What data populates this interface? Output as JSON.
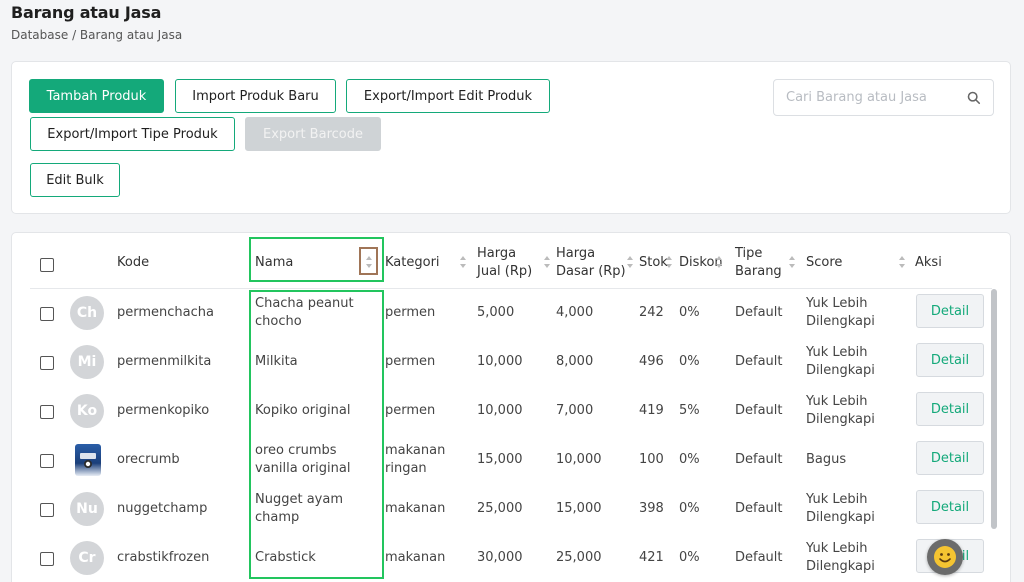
{
  "page": {
    "title": "Barang atau Jasa",
    "breadcrumb": "Database / Barang atau Jasa"
  },
  "toolbar": {
    "tambah_produk": "Tambah Produk",
    "import_produk_baru": "Import Produk Baru",
    "export_import_edit_produk": "Export/Import Edit Produk",
    "export_import_tipe_produk": "Export/Import Tipe Produk",
    "export_barcode": "Export Barcode",
    "edit_bulk": "Edit Bulk"
  },
  "search": {
    "placeholder": "Cari Barang atau Jasa",
    "value": ""
  },
  "table": {
    "headers": {
      "kode": "Kode",
      "nama": "Nama",
      "kategori": "Kategori",
      "harga_jual_1": "Harga",
      "harga_jual_2": "Jual (Rp)",
      "harga_dasar_1": "Harga",
      "harga_dasar_2": "Dasar (Rp)",
      "stok": "Stok",
      "diskon": "Diskon",
      "tipe_barang_1": "Tipe",
      "tipe_barang_2": "Barang",
      "score": "Score",
      "aksi": "Aksi"
    },
    "rows": [
      {
        "avatar": "Ch",
        "kode": "permenchacha",
        "nama_1": "Chacha peanut",
        "nama_2": "chocho",
        "kategori_1": "permen",
        "kategori_2": "",
        "harga_jual": "5,000",
        "harga_dasar": "4,000",
        "stok": "242",
        "diskon": "0%",
        "tipe": "Default",
        "score_1": "Yuk Lebih",
        "score_2": "Dilengkapi",
        "aksi": "Detail"
      },
      {
        "avatar": "Mi",
        "kode": "permenmilkita",
        "nama_1": "Milkita",
        "nama_2": "",
        "kategori_1": "permen",
        "kategori_2": "",
        "harga_jual": "10,000",
        "harga_dasar": "8,000",
        "stok": "496",
        "diskon": "0%",
        "tipe": "Default",
        "score_1": "Yuk Lebih",
        "score_2": "Dilengkapi",
        "aksi": "Detail"
      },
      {
        "avatar": "Ko",
        "kode": "permenkopiko",
        "nama_1": "Kopiko original",
        "nama_2": "",
        "kategori_1": "permen",
        "kategori_2": "",
        "harga_jual": "10,000",
        "harga_dasar": "7,000",
        "stok": "419",
        "diskon": "5%",
        "tipe": "Default",
        "score_1": "Yuk Lebih",
        "score_2": "Dilengkapi",
        "aksi": "Detail"
      },
      {
        "avatar": "",
        "kode": "orecrumb",
        "nama_1": "oreo crumbs",
        "nama_2": "vanilla original",
        "kategori_1": "makanan",
        "kategori_2": "ringan",
        "harga_jual": "15,000",
        "harga_dasar": "10,000",
        "stok": "100",
        "diskon": "0%",
        "tipe": "Default",
        "score_1": "Bagus",
        "score_2": "",
        "aksi": "Detail"
      },
      {
        "avatar": "Nu",
        "kode": "nuggetchamp",
        "nama_1": "Nugget ayam",
        "nama_2": "champ",
        "kategori_1": "makanan",
        "kategori_2": "",
        "harga_jual": "25,000",
        "harga_dasar": "15,000",
        "stok": "398",
        "diskon": "0%",
        "tipe": "Default",
        "score_1": "Yuk Lebih",
        "score_2": "Dilengkapi",
        "aksi": "Detail"
      },
      {
        "avatar": "Cr",
        "kode": "crabstikfrozen",
        "nama_1": "Crabstick",
        "nama_2": "",
        "kategori_1": "makanan",
        "kategori_2": "",
        "harga_jual": "30,000",
        "harga_dasar": "25,000",
        "stok": "421",
        "diskon": "0%",
        "tipe": "Default",
        "score_1": "Yuk Lebih",
        "score_2": "Dilengkapi",
        "aksi": "Detail"
      }
    ]
  },
  "colors": {
    "primary": "#14a97a",
    "highlight_green": "#22c55e",
    "highlight_brown": "#a07557"
  },
  "icons": {
    "search": "search-icon",
    "sort": "sort-icon",
    "product_image": "product-image-icon",
    "chat": "smiley-chat-icon"
  }
}
